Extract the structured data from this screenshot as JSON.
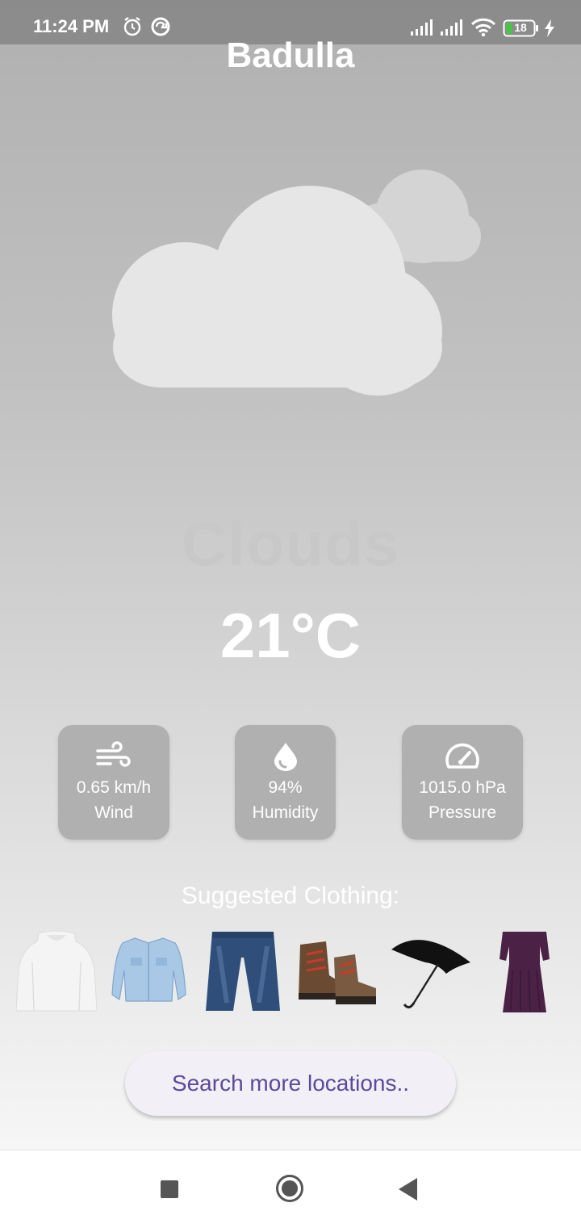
{
  "status_bar": {
    "time": "11:24 PM",
    "battery": "18",
    "icons": [
      "alarm-icon",
      "sync-icon",
      "signal-icon",
      "signal-icon",
      "wifi-icon",
      "battery-icon",
      "charging-icon"
    ]
  },
  "weather": {
    "city": "Badulla",
    "condition": "Clouds",
    "temperature": "21°C",
    "condition_icon": "cloud-icon"
  },
  "stats": [
    {
      "icon": "wind-icon",
      "value": "0.65 km/h",
      "label": "Wind"
    },
    {
      "icon": "water-drop-icon",
      "value": "94%",
      "label": "Humidity"
    },
    {
      "icon": "speedometer-icon",
      "value": "1015.0 hPa",
      "label": "Pressure"
    }
  ],
  "clothing": {
    "title": "Suggested Clothing:",
    "items": [
      "hoodie",
      "denim-jacket",
      "jeans",
      "hiking-boots",
      "umbrella",
      "long-dress"
    ]
  },
  "actions": {
    "search_label": "Search more locations.."
  },
  "nav": [
    "recents-button",
    "home-button",
    "back-button"
  ],
  "colors": {
    "accent": "#5b4a9a",
    "card_bg": "#b0b0b0",
    "button_bg": "#f3eff7"
  }
}
